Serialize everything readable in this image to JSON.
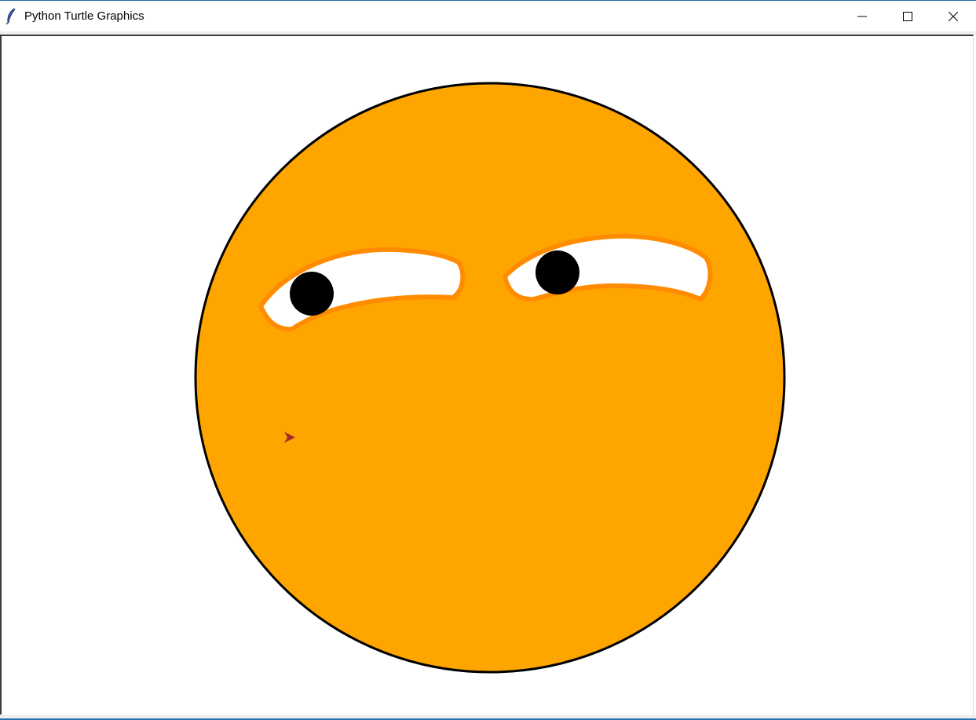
{
  "window": {
    "title": "Python Turtle Graphics",
    "controls": {
      "minimize_icon": "minimize-icon",
      "maximize_icon": "maximize-icon",
      "close_icon": "close-icon"
    },
    "app_icon": "feather-icon"
  },
  "canvas": {
    "background": "#ffffff",
    "drawing": {
      "face": {
        "fill": "#ffa500",
        "stroke": "#000000"
      },
      "eyes": {
        "fill": "#ffffff",
        "stroke": "#ff8c00"
      },
      "pupils": {
        "fill": "#000000"
      },
      "turtle_cursor": {
        "fill": "#a52a2a",
        "shape": "arrow"
      }
    }
  }
}
